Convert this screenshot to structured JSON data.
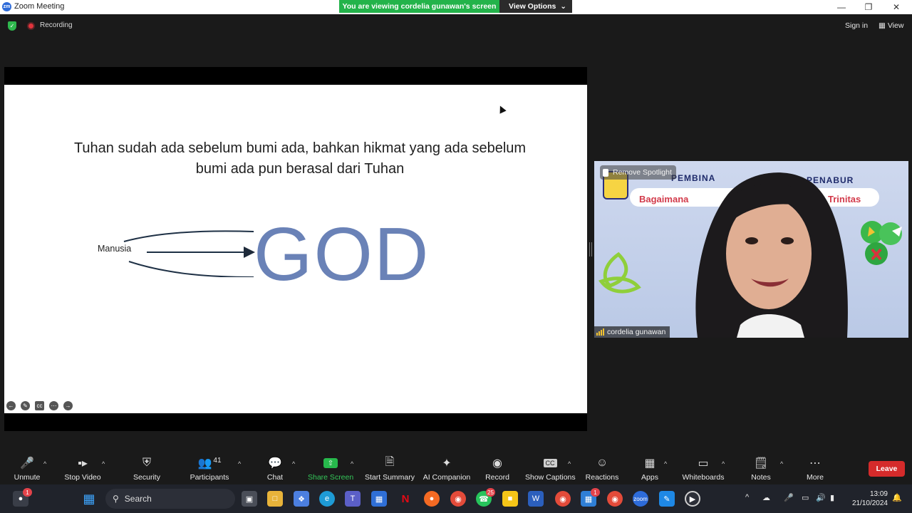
{
  "window": {
    "title": "Zoom Meeting",
    "viewing_banner": "You are viewing cordelia gunawan's screen",
    "view_options": "View Options"
  },
  "meeting_bar": {
    "recording": "Recording",
    "sign_in": "Sign in",
    "view": "View"
  },
  "slide": {
    "line1": "Tuhan sudah ada sebelum bumi ada, bahkan hikmat yang ada sebelum",
    "line2": "bumi ada pun berasal dari Tuhan",
    "left_label": "Manusia",
    "big_word": "GOD"
  },
  "video": {
    "participant_name": "cordelia gunawan",
    "spotlight_label": "Remove Spotlight",
    "banner_left": "PEMBINA",
    "banner_right": "PENABUR",
    "banner_sub_left": "Bagaimana",
    "banner_sub_right": "llah Trinitas"
  },
  "toolbar": {
    "items": [
      {
        "label": "Unmute",
        "icon": "mic-muted-icon"
      },
      {
        "label": "Stop Video",
        "icon": "video-camera-icon"
      },
      {
        "label": "Security",
        "icon": "shield-icon"
      },
      {
        "label": "Participants",
        "icon": "participants-icon",
        "count": "41"
      },
      {
        "label": "Chat",
        "icon": "chat-icon"
      },
      {
        "label": "Share Screen",
        "icon": "share-screen-icon"
      },
      {
        "label": "Start Summary",
        "icon": "summary-icon"
      },
      {
        "label": "AI Companion",
        "icon": "sparkle-icon"
      },
      {
        "label": "Record",
        "icon": "record-icon"
      },
      {
        "label": "Show Captions",
        "icon": "cc-icon"
      },
      {
        "label": "Reactions",
        "icon": "emoji-icon"
      },
      {
        "label": "Apps",
        "icon": "apps-icon"
      },
      {
        "label": "Whiteboards",
        "icon": "whiteboard-icon"
      },
      {
        "label": "Notes",
        "icon": "notes-icon"
      },
      {
        "label": "More",
        "icon": "ellipsis-icon"
      }
    ],
    "leave": "Leave",
    "accent_share": "#27b94c",
    "leave_color": "#d52b2b"
  },
  "taskbar": {
    "search_label": "Search",
    "whatsapp_badge": "25",
    "calendar_badge": "1",
    "notification_badge": "1",
    "time": "13:09",
    "date": "21/10/2024"
  }
}
